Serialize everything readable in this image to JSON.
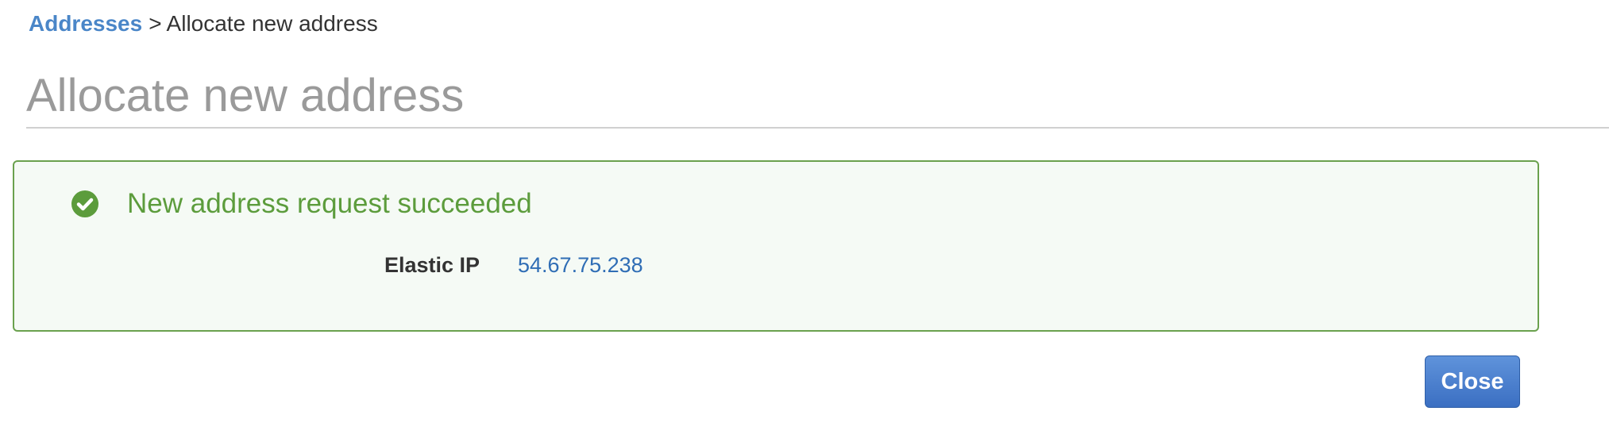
{
  "breadcrumb": {
    "parent_label": "Addresses",
    "separator": ">",
    "current_label": "Allocate new address"
  },
  "page": {
    "title": "Allocate new address"
  },
  "success_panel": {
    "message": "New address request succeeded",
    "icon": "check-circle-icon",
    "field_label": "Elastic IP",
    "field_value": "54.67.75.238"
  },
  "actions": {
    "close_label": "Close"
  },
  "colors": {
    "link": "#4a86c8",
    "success": "#5c9c3c",
    "success_border": "#6aa14e",
    "success_bg": "#f5faf5",
    "ip_value": "#2f6db5",
    "primary_button": "#3b6fc2",
    "title": "#9a9a9a"
  }
}
